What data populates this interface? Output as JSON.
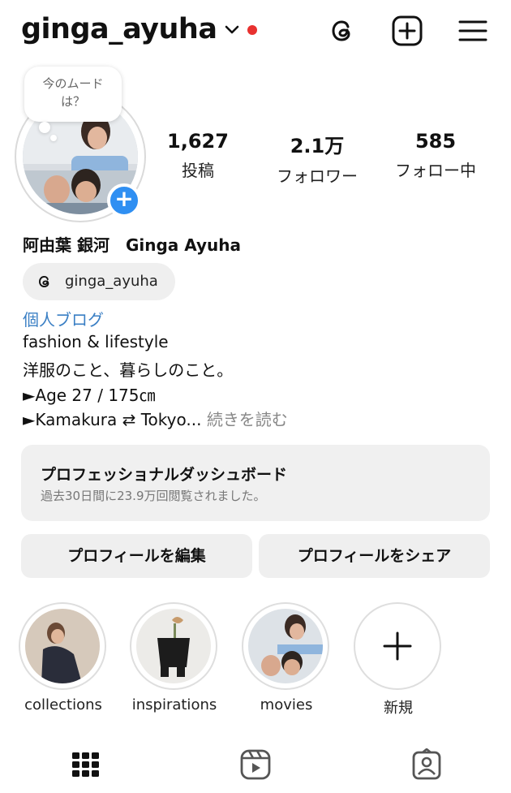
{
  "header": {
    "username": "ginga_ayuha",
    "notification_color": "#e8312f",
    "icons": [
      "threads-icon",
      "create-post-icon",
      "menu-icon"
    ]
  },
  "profile": {
    "note_bubble": "今のムード\nは？",
    "stats": [
      {
        "value": "1,627",
        "label": "投稿"
      },
      {
        "value": "2.1万",
        "label": "フォロワー"
      },
      {
        "value": "585",
        "label": "フォロー中"
      }
    ],
    "full_name": "阿由葉 銀河　Ginga Ayuha",
    "threads_handle": "ginga_ayuha",
    "category_link": "個人ブログ",
    "bio": [
      "fashion & lifestyle",
      "洋服のこと、暮らしのこと。",
      "►Age 27 / 175㎝",
      "►Kamakura ⇄ Tokyo..."
    ],
    "more_label": "続きを読む",
    "link_color": "#3a7fc4"
  },
  "dashboard": {
    "title": "プロフェッショナルダッシュボード",
    "subtitle": "過去30日間に23.9万回閲覧されました。"
  },
  "buttons": {
    "edit": "プロフィールを編集",
    "share": "プロフィールをシェア"
  },
  "highlights": [
    {
      "label": "collections"
    },
    {
      "label": "inspirations"
    },
    {
      "label": "movies"
    },
    {
      "label": "新規"
    }
  ],
  "accent_color": "#2f8ff2"
}
